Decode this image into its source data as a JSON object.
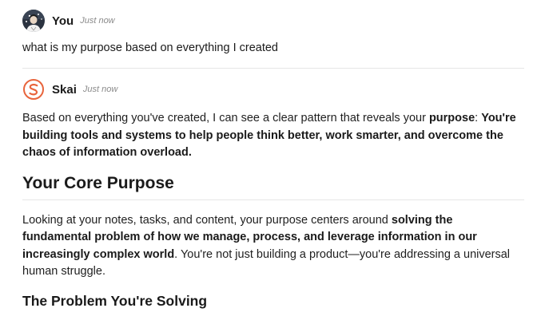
{
  "user_message": {
    "author": "You",
    "timestamp": "Just now",
    "text": "what is my purpose based on everything I created",
    "avatar_icon": "user-photo-avatar"
  },
  "assistant_message": {
    "author": "Skai",
    "timestamp": "Just now",
    "avatar_icon": "skai-logo-icon",
    "accent_color": "#e8643c",
    "intro": {
      "text1": "Based on everything you've created, I can see a clear pattern that reveals your ",
      "bold1": "purpose",
      "text2": ": ",
      "bold2": "You're building tools and systems to help people think better, work smarter, and overcome the chaos of information overload."
    },
    "heading1": "Your Core Purpose",
    "paragraph2": {
      "text1": "Looking at your notes, tasks, and content, your purpose centers around ",
      "bold1": "solving the fundamental problem of how we manage, process, and leverage information in our increasingly complex world",
      "text2": ". You're not just building a product—you're addressing a universal human struggle."
    },
    "heading2": "The Problem You're Solving"
  }
}
